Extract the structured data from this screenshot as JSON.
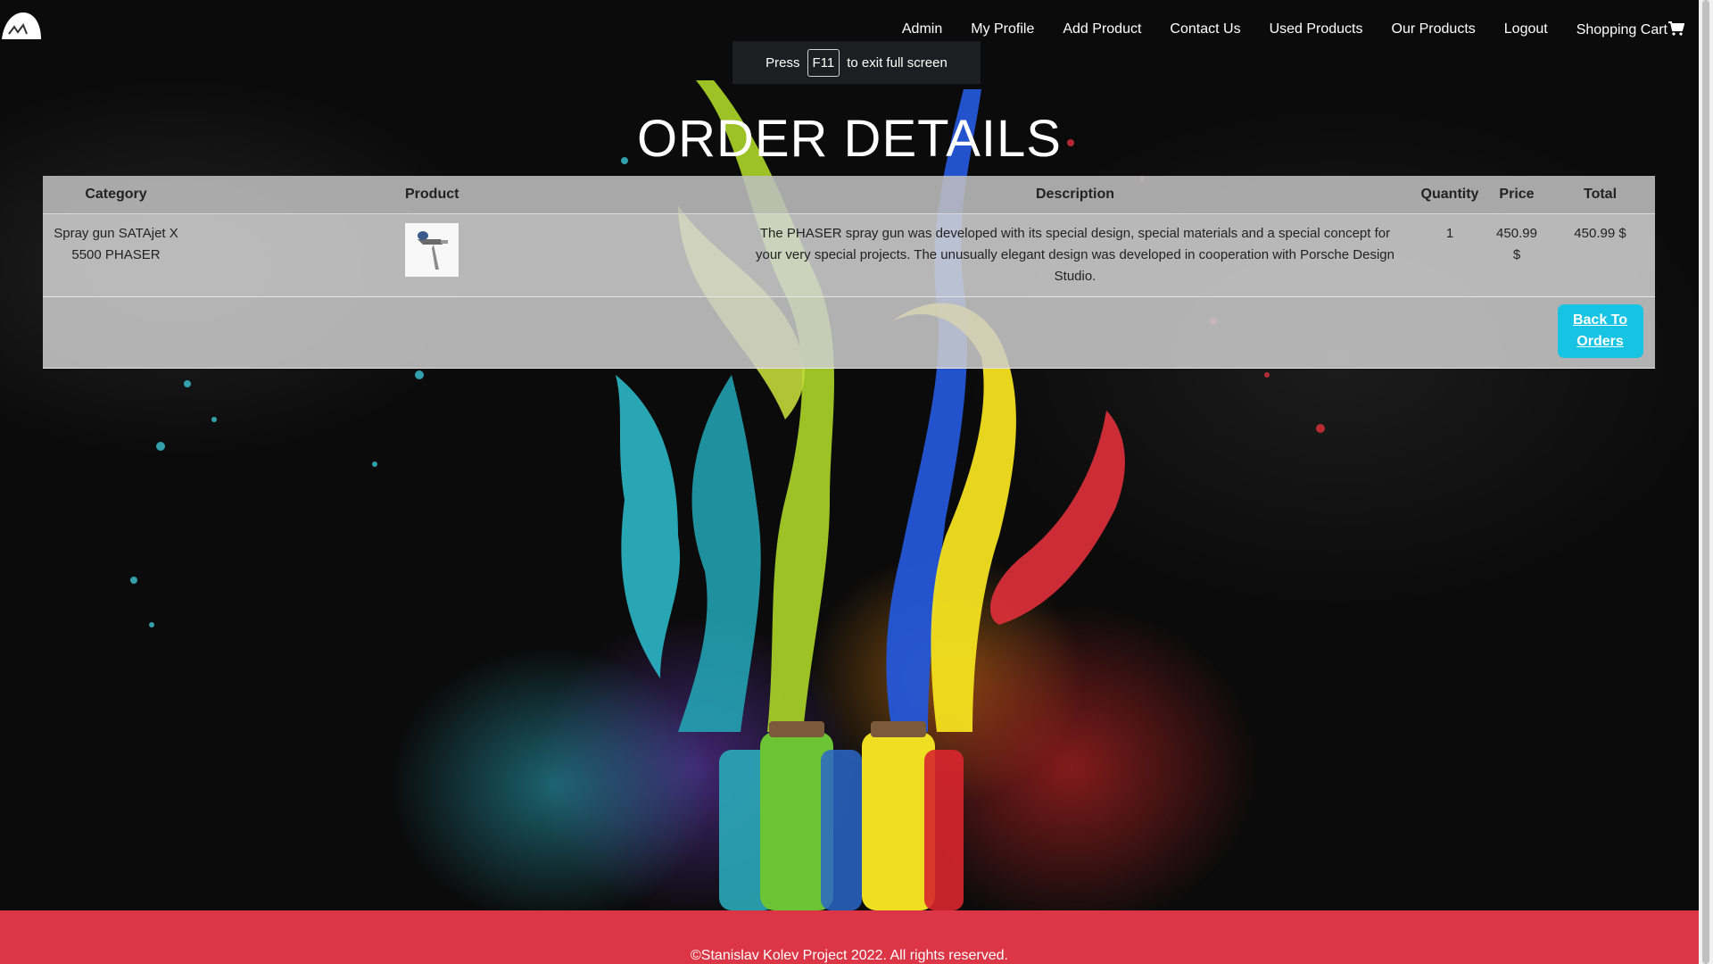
{
  "nav": {
    "logo": "paint-splash-logo",
    "items": [
      {
        "label": "Admin"
      },
      {
        "label": "My Profile"
      },
      {
        "label": "Add Product"
      },
      {
        "label": "Contact Us"
      },
      {
        "label": "Used Products"
      },
      {
        "label": "Our Products"
      },
      {
        "label": "Logout"
      },
      {
        "label": "Shopping Cart",
        "icon": "shopping-cart-icon"
      }
    ]
  },
  "fullscreen_notice": {
    "before": "Press",
    "key": "F11",
    "after": "to exit full screen"
  },
  "page": {
    "title": "ORDER DETAILS"
  },
  "table": {
    "headers": [
      "Category",
      "Product",
      "Description",
      "Quantity",
      "Price",
      "Total"
    ],
    "rows": [
      {
        "category": "Spray gun SATAjet X 5500 PHASER",
        "product_image": "spray-gun-thumbnail",
        "description": "The PHASER spray gun was developed with its special design, special materials and a special concept for your very special projects. The unusually elegant design was developed in cooperation with Porsche Design Studio.",
        "quantity": "1",
        "price": "450.99 $",
        "total": "450.99 $"
      }
    ],
    "back_button": "Back To Orders"
  },
  "footer": {
    "text": "©Stanislav Kolev Project 2022. All rights reserved."
  },
  "colors": {
    "footer_bg": "#dc3545",
    "button_bg": "#17c3e3"
  }
}
